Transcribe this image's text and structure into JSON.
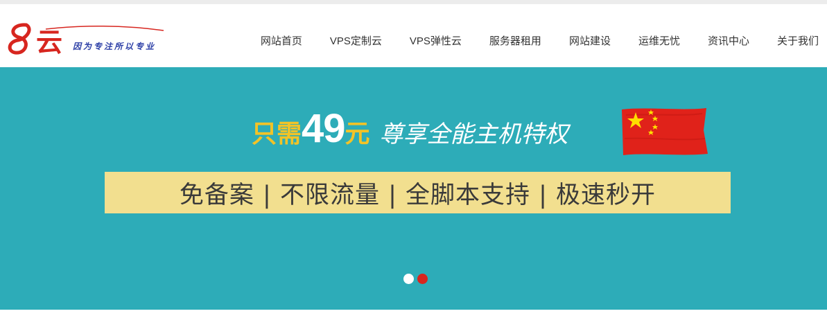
{
  "logo": {
    "mark_text": "云",
    "tagline": "因为专注所以专业",
    "colors": {
      "mark": "#d7261f",
      "tagline": "#2b3ea6"
    }
  },
  "nav": {
    "items": [
      {
        "label": "网站首页"
      },
      {
        "label": "VPS定制云"
      },
      {
        "label": "VPS弹性云"
      },
      {
        "label": "服务器租用"
      },
      {
        "label": "网站建设"
      },
      {
        "label": "运维无忧"
      },
      {
        "label": "资讯中心"
      },
      {
        "label": "关于我们"
      }
    ]
  },
  "banner": {
    "background_color": "#2dacb8",
    "headline_prefix": "只需",
    "headline_price": "49",
    "headline_unit": "元",
    "headline_slogan": "尊享全能主机特权",
    "features_text": "免备案 |  不限流量 | 全脚本支持 | 极速秒开",
    "flag_icon": "china-flag-icon",
    "colors": {
      "accent_yellow": "#f2c327",
      "feature_bar": "#f2df8f",
      "active_dot": "#d7261f"
    },
    "carousel": {
      "slides": 2,
      "active_index": 2
    }
  }
}
